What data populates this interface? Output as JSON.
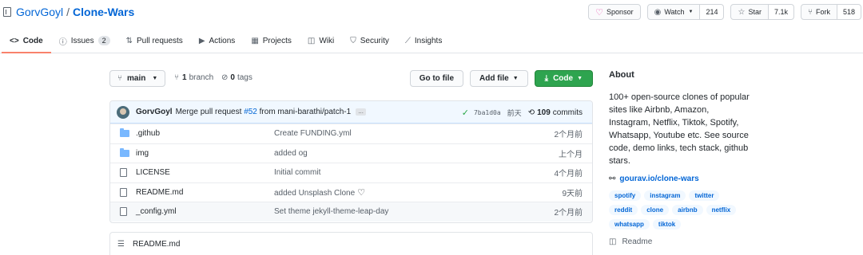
{
  "repo": {
    "owner": "GorvGoyl",
    "separator": "/",
    "name": "Clone-Wars"
  },
  "header_actions": {
    "sponsor": "Sponsor",
    "watch": "Watch",
    "watch_count": "214",
    "star": "Star",
    "star_count": "7.1k",
    "fork": "Fork",
    "fork_count": "518"
  },
  "tabs": [
    {
      "label": "Code",
      "icon": "code-icon"
    },
    {
      "label": "Issues",
      "icon": "issue-icon",
      "badge": "2"
    },
    {
      "label": "Pull requests",
      "icon": "pull-request-icon"
    },
    {
      "label": "Actions",
      "icon": "play-icon"
    },
    {
      "label": "Projects",
      "icon": "project-icon"
    },
    {
      "label": "Wiki",
      "icon": "book-icon"
    },
    {
      "label": "Security",
      "icon": "shield-icon"
    },
    {
      "label": "Insights",
      "icon": "graph-icon"
    }
  ],
  "nav": {
    "branch": "main",
    "branches_count": "1",
    "branches_label": "branch",
    "tags_count": "0",
    "tags_label": "tags",
    "go_to_file": "Go to file",
    "add_file": "Add file",
    "code": "Code"
  },
  "commit": {
    "author": "GorvGoyl",
    "msg_prefix": "Merge pull request",
    "pr": "#52",
    "msg_suffix": "from mani-barathi/patch-1",
    "ellipsis": "…",
    "sha": "7ba1d0a",
    "when": "前天",
    "commits_count": "109",
    "commits_label": "commits"
  },
  "files": [
    {
      "type": "folder",
      "name": ".github",
      "message": "Create FUNDING.yml",
      "age": "2个月前"
    },
    {
      "type": "folder",
      "name": "img",
      "message": "added og",
      "age": "上个月"
    },
    {
      "type": "file",
      "name": "LICENSE",
      "message": "Initial commit",
      "age": "4个月前"
    },
    {
      "type": "file",
      "name": "README.md",
      "message": "added Unsplash Clone",
      "age": "9天前"
    },
    {
      "type": "file",
      "name": "_config.yml",
      "message": "Set theme jekyll-theme-leap-day",
      "age": "2个月前"
    }
  ],
  "readme_box": {
    "title": "README.md"
  },
  "about": {
    "heading": "About",
    "description": "100+ open-source clones of popular sites like Airbnb, Amazon, Instagram, Netflix, Tiktok, Spotify, Whatsapp, Youtube etc. See source code, demo links, tech stack, github stars.",
    "website": "gourav.io/clone-wars",
    "topics": [
      "spotify",
      "instagram",
      "twitter",
      "reddit",
      "clone",
      "airbnb",
      "netflix",
      "whatsapp",
      "tiktok"
    ],
    "readme": "Readme"
  },
  "colors": {
    "accent": "#0366d6",
    "green": "#2ea44f",
    "tab_underline": "#f9826c",
    "sponsor": "#ea4aaa"
  }
}
